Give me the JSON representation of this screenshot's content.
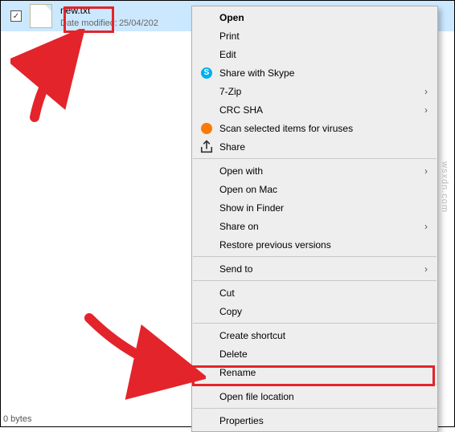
{
  "file": {
    "name": "new.txt",
    "date_label": "Date modified:",
    "date_value": "25/04/202"
  },
  "menu": {
    "open": "Open",
    "print": "Print",
    "edit": "Edit",
    "skype": "Share with Skype",
    "sevenzip": "7-Zip",
    "crc": "CRC SHA",
    "scan": "Scan selected items for viruses",
    "share": "Share",
    "open_with": "Open with",
    "open_mac": "Open on Mac",
    "show_finder": "Show in Finder",
    "share_on": "Share on",
    "restore": "Restore previous versions",
    "send_to": "Send to",
    "cut": "Cut",
    "copy": "Copy",
    "create_shortcut": "Create shortcut",
    "delete": "Delete",
    "rename": "Rename",
    "open_file_location": "Open file location",
    "properties": "Properties"
  },
  "footer": "0 bytes",
  "watermark": "wsxdn.com"
}
